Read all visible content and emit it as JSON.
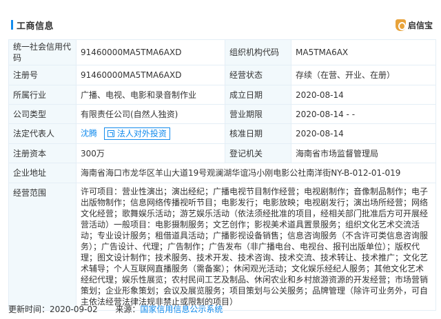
{
  "header": {
    "title": "工商信息",
    "brand": "启信宝"
  },
  "rows": [
    {
      "l1": "统一社会信用代码",
      "v1": "91460000MA5TMA6AXD",
      "l2": "组织机构代码",
      "v2": "MA5TMA6AX"
    },
    {
      "l1": "注册号",
      "v1": "91460000MA5TMA6AXD",
      "l2": "经营状态",
      "v2": "存续（在营、开业、在册）"
    },
    {
      "l1": "所属行业",
      "v1": "广播、电视、电影和录音制作业",
      "l2": "成立日期",
      "v2": "2020-08-14"
    },
    {
      "l1": "公司类型",
      "v1": "有限责任公司(自然人独资)",
      "l2": "营业期限",
      "v2": "2020-08-14 - -"
    },
    {
      "l1": "法定代表人",
      "v1": "沈腾",
      "btn": "法人对外投资",
      "l2": "核准日期",
      "v2": "2020-08-14"
    },
    {
      "l1": "注册资本",
      "v1": "300万",
      "l2": "登记机关",
      "v2": "海南省市场监督管理局"
    }
  ],
  "address": {
    "label": "企业地址",
    "value": "海南省海口市龙华区羊山大道19号观澜湖华谊冯小刚电影公社南洋街NY-B-012-01-019"
  },
  "scope": {
    "label": "经营范围",
    "value": "许可项目：营业性演出；演出经纪；广播电视节目制作经营；电视剧制作；音像制品制作；电子出版物制作；信息网络传播视听节目；电影发行；电影放映；电视剧发行；演出场所经营；网络文化经营；歌舞娱乐活动；游艺娱乐活动（依法须经批准的项目，经相关部门批准后方可开展经营活动）一般项目：电影摄制服务；文艺创作；影视美术道具置景服务；组织文化艺术交流活动；专业设计服务；租借道具活动；广播影视设备销售；信息咨询服务（不含许可类信息咨询服务）；广告设计、代理；广告制作；广告发布（非广播电台、电视台、报刊出版单位）；版权代理；图文设计制作；技术服务、技术开发、技术咨询、技术交流、技术转让、技术推广；文化艺术辅导；个人互联网直播服务（需备案）；休闲观光活动；文化娱乐经纪人服务；其他文化艺术经纪代理；娱乐性展览；农村民间工艺及制品、休闲农业和乡村旅游资源的开发经营；市场营销策划；企业形象策划；会议及展览服务；项目策划与公关服务；品牌管理（除许可业务外，可自主依法经营法律法规非禁止或限制的项目）"
  },
  "footer": {
    "update_label": "更新时间：2020-09-02",
    "source_label": "来源：",
    "source_link": "国家信用信息公示系统"
  }
}
